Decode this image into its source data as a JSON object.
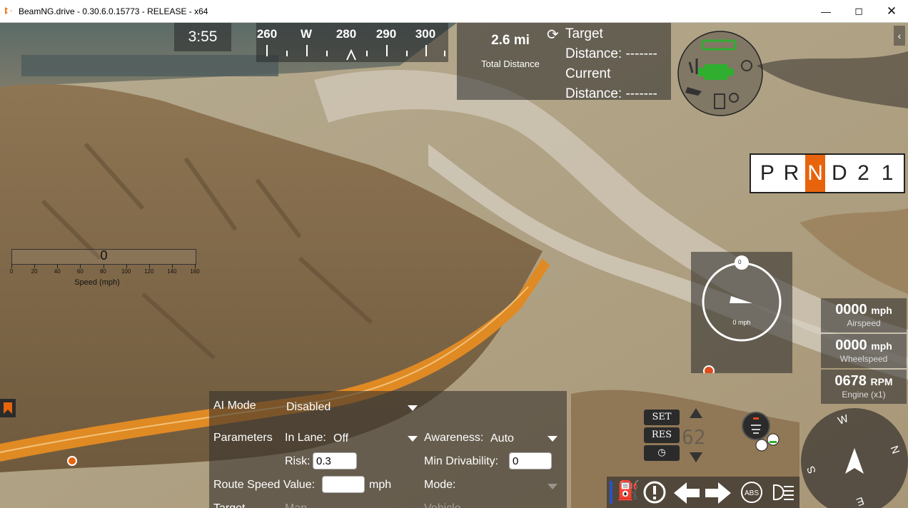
{
  "window": {
    "title": "BeamNG.drive - 0.30.6.0.15773 - RELEASE - x64",
    "controls": [
      "minimize-icon",
      "maximize-icon",
      "close-icon"
    ]
  },
  "hud": {
    "clock": "3:55",
    "compass": {
      "labels": [
        "260",
        "W",
        "280",
        "290",
        "300"
      ]
    },
    "navigation": {
      "total_distance_value": "2.6 mi",
      "total_distance_label": "Total Distance",
      "target_distance_line1": "Target",
      "target_distance_line2": "Distance: -------",
      "current_distance_line1": "Current",
      "current_distance_line2": "Distance: -------"
    },
    "gearbox": {
      "gears": [
        "P",
        "R",
        "N",
        "D",
        "2",
        "1"
      ],
      "active": "N"
    },
    "speedometer": {
      "value": "0",
      "unit": "0 mph"
    },
    "speed_readouts": [
      {
        "value": "0000",
        "unit": "mph",
        "label": "Airspeed"
      },
      {
        "value": "0000",
        "unit": "mph",
        "label": "Wheelspeed"
      },
      {
        "value": "0678",
        "unit": "RPM",
        "label": "Engine (x1)"
      }
    ],
    "speed_ruler": {
      "value": "0",
      "ticks": [
        "0",
        "20",
        "40",
        "60",
        "80",
        "100",
        "120",
        "140",
        "160"
      ],
      "label": "Speed (mph)"
    },
    "cruise_control": {
      "set_label": "SET",
      "res_label": "RES",
      "speed_value": "62"
    },
    "minimap_directions": {
      "w": "W",
      "n": "N",
      "s": "S",
      "e": "E"
    }
  },
  "ai_panel": {
    "mode_label": "AI Mode",
    "mode_value": "Disabled",
    "parameters_label": "Parameters",
    "in_lane_label": "In Lane:",
    "in_lane_value": "Off",
    "awareness_label": "Awareness:",
    "awareness_value": "Auto",
    "risk_label": "Risk:",
    "risk_value": "0.3",
    "min_drivability_label": "Min Drivability:",
    "min_drivability_value": "0",
    "route_speed_label": "Route Speed Value:",
    "route_speed_value": "",
    "route_speed_unit": "mph",
    "mode2_label": "Mode:",
    "target_label": "Target",
    "man_label": "Man",
    "vehicle_label": "Vehicle"
  },
  "colors": {
    "accent": "#e8640c",
    "panel": "#282828",
    "terrain": "#8c7a5c"
  }
}
